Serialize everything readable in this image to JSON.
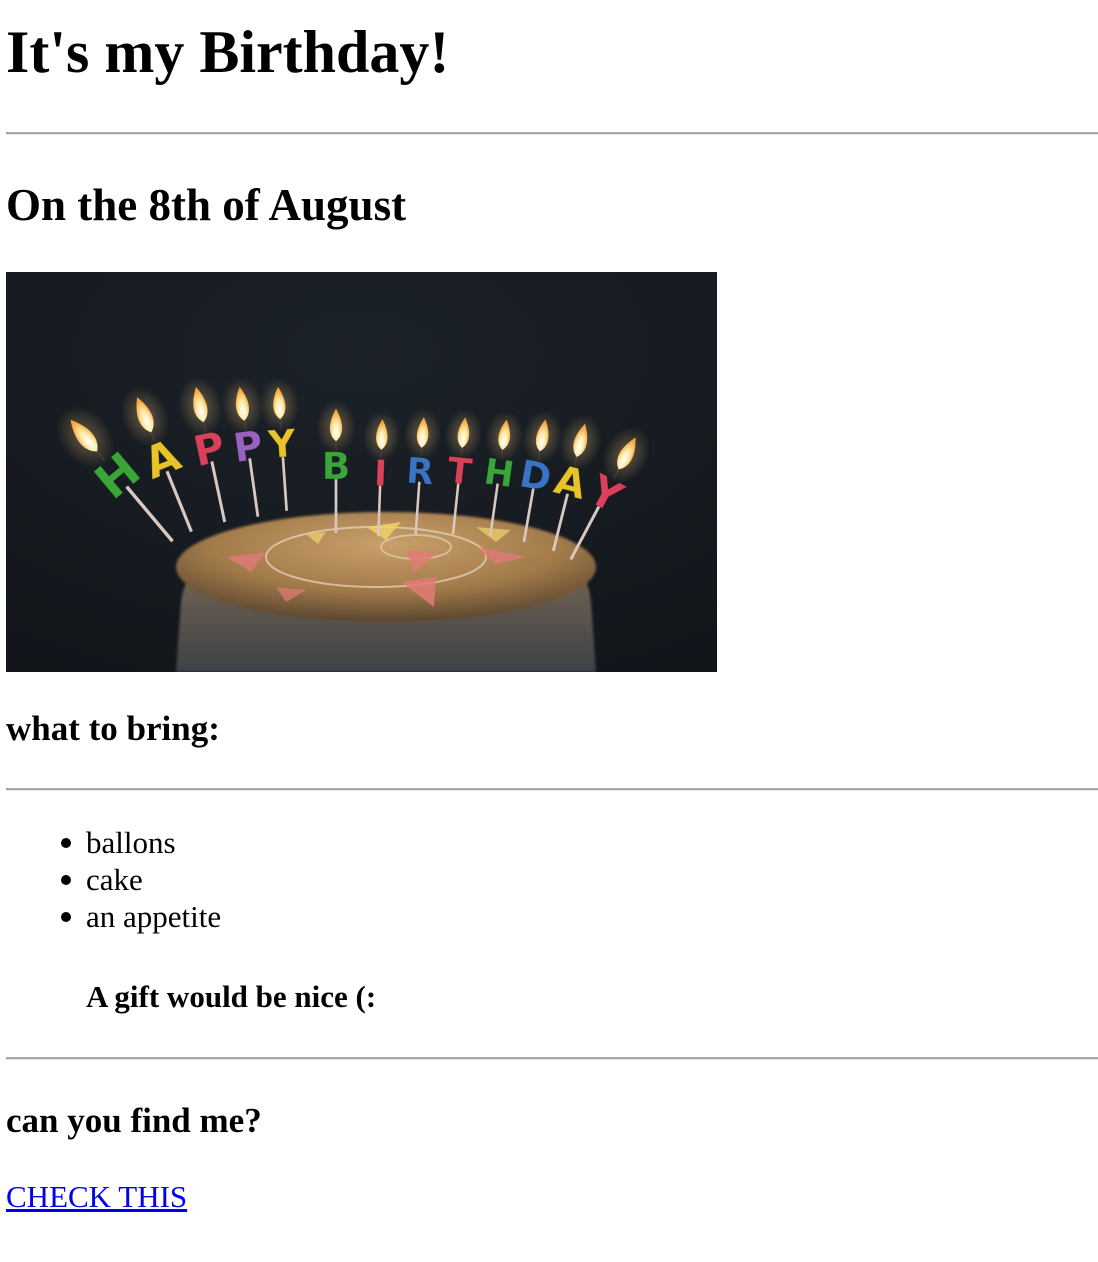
{
  "heading": "It's my Birthday!",
  "date_heading": "On the 8th of August",
  "image": {
    "alt": "birthday cake with HAPPY BIRTHDAY candles",
    "candle_letters": [
      "H",
      "A",
      "P",
      "P",
      "Y",
      "B",
      "I",
      "R",
      "T",
      "H",
      "D",
      "A",
      "Y"
    ],
    "candle_colors": [
      "#3aa63a",
      "#e8c42a",
      "#d9405a",
      "#9a62c0",
      "#e8c42a",
      "#3aa63a",
      "#d9405a",
      "#3b73c4",
      "#d9405a",
      "#3aa63a",
      "#3b73c4",
      "#e8c42a",
      "#d9405a"
    ]
  },
  "bring": {
    "heading": "what to bring:",
    "items": [
      "ballons",
      "cake",
      "an appetite"
    ],
    "note": "A gift would be nice (:"
  },
  "find": {
    "heading": "can you find me?",
    "link_text": "CHECK THIS"
  }
}
